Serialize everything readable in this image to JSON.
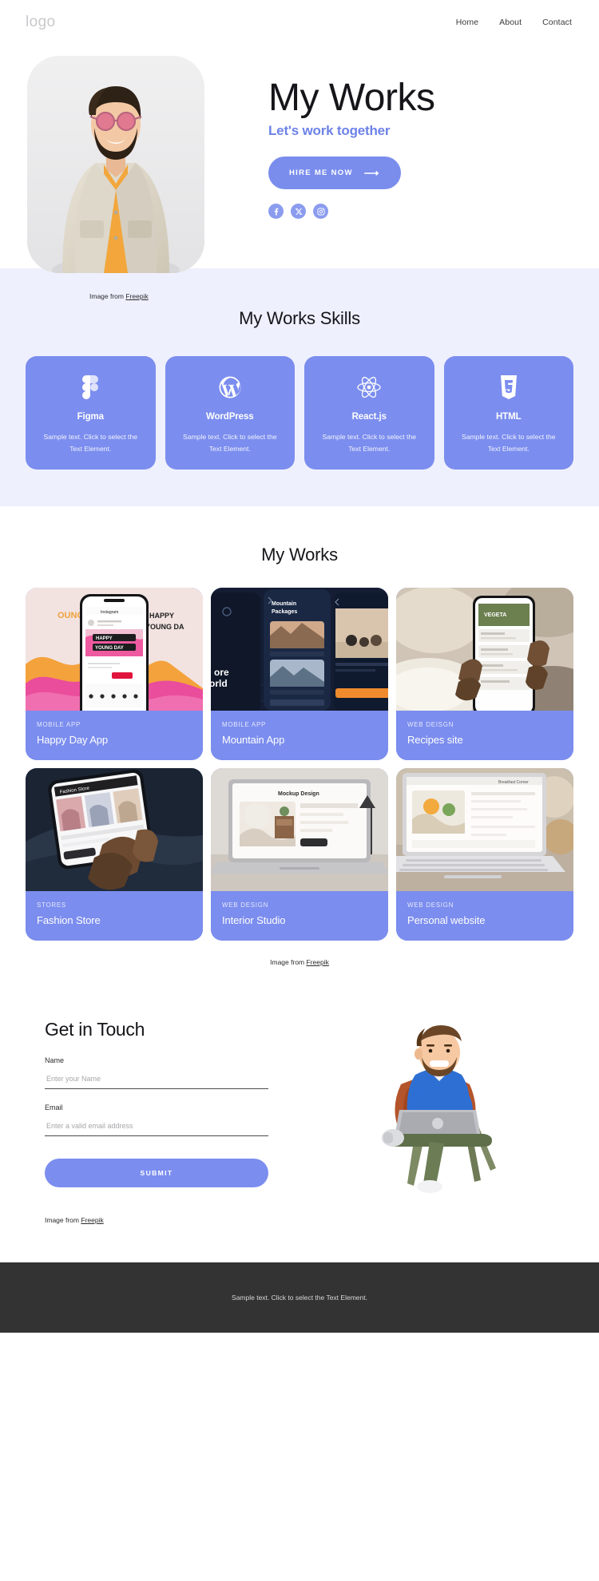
{
  "header": {
    "logo": "logo",
    "nav": [
      {
        "label": "Home"
      },
      {
        "label": "About"
      },
      {
        "label": "Contact"
      }
    ]
  },
  "hero": {
    "title": "My Works",
    "subtitle": "Let's work together",
    "cta_label": "HIRE ME NOW",
    "cta_arrow": "⟶",
    "socials": [
      {
        "name": "facebook-icon"
      },
      {
        "name": "x-twitter-icon"
      },
      {
        "name": "instagram-icon"
      }
    ],
    "credit_prefix": "Image from ",
    "credit_link": "Freepik"
  },
  "skills": {
    "title": "My Works Skills",
    "cards": [
      {
        "icon": "figma-icon",
        "name": "Figma",
        "text": "Sample text. Click to select the Text Element."
      },
      {
        "icon": "wordpress-icon",
        "name": "WordPress",
        "text": "Sample text. Click to select the Text Element."
      },
      {
        "icon": "react-icon",
        "name": "React.js",
        "text": "Sample text. Click to select the Text Element."
      },
      {
        "icon": "html5-icon",
        "name": "HTML",
        "text": "Sample text. Click to select the Text Element."
      }
    ]
  },
  "works": {
    "title": "My Works",
    "items": [
      {
        "category": "MOBILE APP",
        "name": "Happy Day App",
        "thumb": "phone-instagram-pink"
      },
      {
        "category": "MOBILE APP",
        "name": "Mountain App",
        "thumb": "phones-dark-travel"
      },
      {
        "category": "WEB DEISGN",
        "name": "Recipes site",
        "thumb": "hand-phone-recipes"
      },
      {
        "category": "STORES",
        "name": "Fashion Store",
        "thumb": "hand-phone-fashion"
      },
      {
        "category": "WEB DESIGN",
        "name": "Interior Studio",
        "thumb": "laptop-mockup-interior"
      },
      {
        "category": "WEB DESIGN",
        "name": "Personal website",
        "thumb": "laptop-recipes-desk"
      }
    ],
    "credit_prefix": "Image from ",
    "credit_link": "Freepik"
  },
  "contact": {
    "title": "Get in Touch",
    "name_label": "Name",
    "name_placeholder": "Enter your Name",
    "name_value": "",
    "email_label": "Email",
    "email_placeholder": "Enter a valid email address",
    "email_value": "",
    "submit_label": "SUBMIT",
    "credit_prefix": "Image from ",
    "credit_link": "Freepik",
    "illustration": "man-with-laptop-on-chair"
  },
  "footer": {
    "text": "Sample text. Click to select the Text Element."
  },
  "colors": {
    "accent": "#7b8dee",
    "accent_text": "#6d82e8",
    "band": "#eef0fd",
    "footer_bg": "#333334",
    "text": "#15151a"
  }
}
